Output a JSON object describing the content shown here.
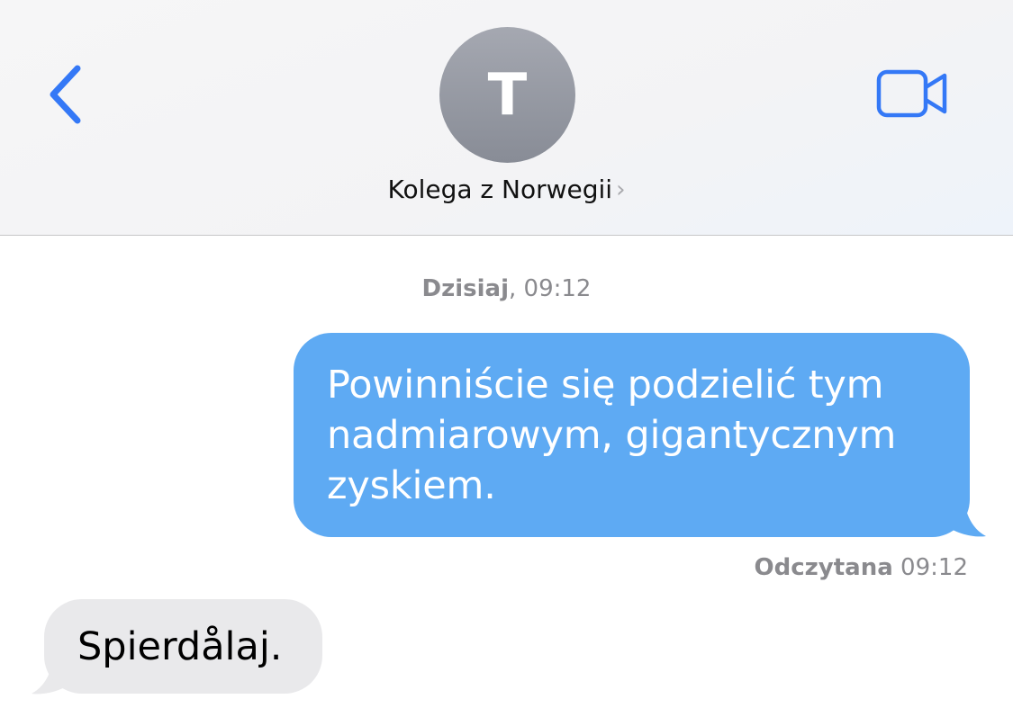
{
  "header": {
    "back_icon": "chevron-left-icon",
    "avatar_initial": "T",
    "contact_name": "Kolega z Norwegii",
    "contact_chevron": "›",
    "video_icon": "video-camera-icon",
    "accent_color": "#3478f6"
  },
  "conversation": {
    "timestamp_day": "Dzisiaj",
    "timestamp_time": ", 09:12",
    "messages": [
      {
        "direction": "outgoing",
        "text": "Powinniście się podzielić tym nadmiarowym, gigantycznym zyskiem.",
        "bubble_color": "#5eaaf3"
      },
      {
        "direction": "incoming",
        "text": "Spierdålaj.",
        "bubble_color": "#e9e9eb"
      }
    ],
    "read_status": "Odczytana",
    "read_time": " 09:12"
  }
}
